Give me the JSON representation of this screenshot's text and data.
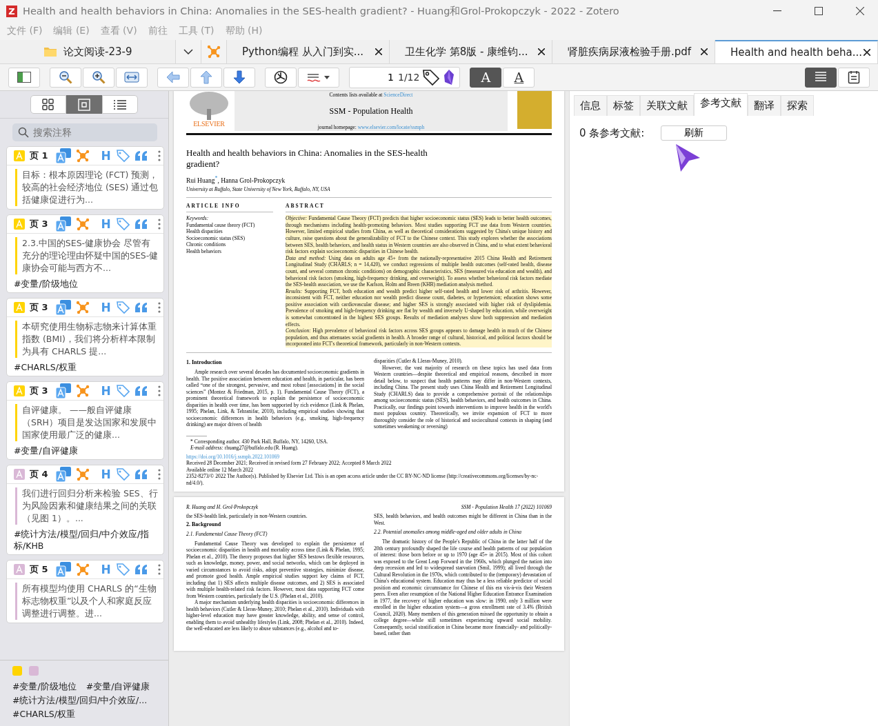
{
  "window": {
    "logo": "Z",
    "title": "Health and health behaviors in China: Anomalies in the SES-health gradient? - Huang和Grol-Prokopczyk - 2022 - Zotero"
  },
  "menu": [
    "文件 (F)",
    "编辑 (E)",
    "查看 (V)",
    "前往",
    "工具 (T)",
    "帮助 (H)"
  ],
  "tabs": [
    {
      "kind": "library",
      "label": "论文阅读-23-9",
      "selected": false
    },
    {
      "kind": "document",
      "label": "Python编程 从入门到实...",
      "selected": false
    },
    {
      "kind": "document",
      "label": "卫生化学 第8版 - 康维钧...",
      "selected": false
    },
    {
      "kind": "document",
      "label": "肾脏疾病尿液检验手册.pdf",
      "selected": false
    },
    {
      "kind": "document",
      "label": "Health and health beha...",
      "selected": true
    }
  ],
  "toolbar": {
    "page_input": "1",
    "page_count": "1/12",
    "font_buttons": [
      {
        "glyph": "A",
        "selected": true
      },
      {
        "glyph": "A",
        "selected": false
      }
    ],
    "views": [
      {
        "selected": true
      },
      {
        "selected": false
      }
    ]
  },
  "annotation_views": [
    {
      "selected": false
    },
    {
      "selected": true
    },
    {
      "selected": false
    }
  ],
  "annotation_search": {
    "placeholder": "搜索注释"
  },
  "annotations": [
    {
      "color": "#ffd400",
      "page": "页 1",
      "heading_glyph": "H",
      "text": "目标：根本原因理论 (FCT) 预测，较高的社会经济地位 (SES) 通过包括健康促进行为..."
    },
    {
      "color": "#ffd400",
      "page": "页 3",
      "heading_glyph": "H",
      "text": "2.3.中国的SES-健康协会 尽管有充分的理论理由怀疑中国的SES-健康协会可能与西方不...",
      "tag": "#变量/阶级地位"
    },
    {
      "color": "#ffd400",
      "page": "页 3",
      "heading_glyph": "H",
      "text": "本研究使用生物标志物来计算体重指数 (BMI)，我们将分析样本限制为具有 CHARLS 提...",
      "tag": "#CHARLS/权重"
    },
    {
      "color": "#ffd400",
      "page": "页 3",
      "heading_glyph": "H",
      "text": "自评健康。 ——般自评健康（SRH）项目是发达国家和发展中国家使用最广泛的健康...",
      "tag": "#变量/自评健康"
    },
    {
      "color": "#d9b8d6",
      "page": "页 4",
      "heading_glyph": "H",
      "text": "我们进行回归分析来检验 SES、行为风险因素和健康结果之间的关联（见图 1）。...",
      "tag": "#统计方法/模型/回归/中介效应/指标/KHB"
    },
    {
      "color": "#d9b8d6",
      "page": "页 5",
      "heading_glyph": "H",
      "text": "所有模型均使用 CHARLS 的“生物标志物权重”以及个人和家庭反应调整进行调整。进..."
    }
  ],
  "annotation_filters": {
    "colors": [
      {
        "color": "#ffd400"
      },
      {
        "color": "#d9b8d6"
      }
    ],
    "tags": [
      "#变量/阶级地位",
      "#变量/自评健康",
      "#统计方法/模型/回归/中介效应/...",
      "#CHARLS/权重"
    ]
  },
  "page_1": {
    "contents_line": "Contents lists available at **ScienceDirect**",
    "journal": "SSM - Population Health",
    "homepage": "journal homepage: **www.elsevier.com/locate/ssmph**",
    "publisher": "ELSEVIER",
    "title": "Health and health behaviors in China: Anomalies in the SES-health gradient?",
    "authors": "Rui Huang$^{*}$, Hanna Grol-Prokopczyk",
    "affiliation": "University at Buffalo, State University of New York, Buffalo, NY, USA",
    "article_info_heading": "ARTICLE INFO",
    "keywords_label": "Keywords:",
    "keywords": [
      "Fundamental cause theory (FCT)",
      "Health disparities",
      "Socioeconomic status (SES)",
      "Chronic conditions",
      "Health behaviors"
    ],
    "abstract_heading": "ABSTRACT",
    "abstract_highlighted": true,
    "abstract": [
      "*Objective:* Fundamental Cause Theory (FCT) predicts that higher socioeconomic status (SES) leads to better health outcomes, through mechanisms including health-promoting behaviors. Most studies supporting FCT use data from Western countries. However, limited empirical studies from China, as well as theoretical considerations suggested by China's unique history and culture, raise questions about the generalizability of FCT to the Chinese context. This study explores whether the associations between SES, health behaviors, and health status in Western countries are also observed in China, and to what extent behavioral risk factors explain socioeconomic disparities in Chinese health.",
      "*Data and method:* Using data on adults age 45+ from the nationally-representative 2015 China Health and Retirement Longitudinal Study (CHARLS; n = 14,420), we conduct regressions of multiple health outcomes (self-rated health, disease count, and several common chronic conditions) on demographic characteristics, SES (measured via education and wealth), and behavioral risk factors (smoking, high-frequency drinking, and overweight). To assess whether behavioral risk factors mediate the SES-health association, we use the Karlson, Holm and Breen (KHB) mediation analysis method.",
      "*Results:* Supporting FCT, both education and wealth predict higher self-rated health and lower risk of arthritis. However, inconsistent with FCT, neither education nor wealth predict disease count, diabetes, or hypertension; education shows some positive association with cardiovascular disease; and higher SES is strongly associated with higher risk of dyslipidemia. Prevalence of smoking and high-frequency drinking are flat by wealth and inversely U-shaped by education, while overweight is somewhat concentrated in the highest SES groups. Results of mediation analyses show both suppression and mediation effects.",
      "*Conclusion:* High prevalence of behavioral risk factors across SES groups appears to damage health in much of the Chinese population, and thus attenuates social gradients in health. A broader range of cultural, historical, and political factors should be incorporated into FCT's theoretical framework, particularly in non-Western contexts."
    ],
    "intro_heading": "1.  Introduction",
    "intro_left": [
      "Ample research over several decades has documented socioeconomic gradients in health. The positive association between education and health, in particular, has been called “one of the strongest, pervasive, and most robust [associations] in the social sciences” (Montez & Friedman, 2015, p. 1). Fundamental Cause Theory (FCT), a prominent theoretical framework to explain the persistence of socioeconomic disparities in health over time, has been supported by rich evidence (Link & Phelan, 1995; Phelan, Link, & Tehranifar, 2010), including empirical studies showing that socioeconomic differences in health behaviors (e.g., smoking, high-frequency drinking) are major drivers of health"
    ],
    "intro_right": [
      "disparities (Cutler & Lleras-Muney, 2010).",
      "However, the vast majority of research on these topics has used data from Western countries—despite theoretical and empirical reasons, described in more detail below, to suspect that health patterns may differ in non-Western contexts, including China. The present study uses China Health and Retirement Longitudinal Study (CHARLS) data to provide a comprehensive portrait of the relationships among socioeconomic status (SES), health behaviors, and health outcomes in China. Practically, our findings point towards interventions to improve health in the world's most populous country. Theoretically, we invite expansion of FCT to more thoroughly consider the role of historical and sociocultural contexts in shaping (and sometimes weakening or reversing)"
    ],
    "footnotes": [
      "* Corresponding author. 430 Park Hall, Buffalo, NY, 14260, USA.",
      "*E-mail address:* rhuang27@buffalo.edu (R. Huang)."
    ],
    "doi": "https://doi.org/10.1016/j.ssmph.2022.101069",
    "dates": [
      "Received 28 December 2021; Received in revised form 27 February 2022; Accepted 8 March 2022",
      "Available online 12 March 2022",
      "2352-8273/© 2022 The Author(s). Published by Elsevier Ltd. This is an open access article under the CC BY-NC-ND license (http://creativecommons.org/licenses/by-nc-nd/4.0/)."
    ]
  },
  "page_2": {
    "running_left": "R. Huang and H. Grol-Prokopczyk",
    "running_right": "SSM - Population Health 17 (2022) 101069",
    "left": [
      {
        "kind": "text",
        "text": "the SES-health link, particularly in non-Western countries."
      },
      {
        "kind": "heading",
        "text": "2.  Background"
      },
      {
        "kind": "subheading",
        "text": "2.1.  Fundamental Cause Theory (FCT)"
      },
      {
        "kind": "paragraph",
        "text": "Fundamental Cause Theory was developed to explain the persistence of socioeconomic disparities in health and mortality across time (Link & Phelan, 1995; Phelan et al., 2010). The theory proposes that higher SES bestows flexible resources, such as knowledge, money, power, and social networks, which can be deployed in varied circumstances to avoid risks, adopt preventive strategies, minimize disease, and promote good health. Ample empirical studies support key claims of FCT, including that 1) SES affects multiple disease outcomes, and 2) SES is associated with multiple health-related risk factors. However, most data supporting FCT come from Western countries, particularly the U.S. (Phelan et al., 2010)."
      },
      {
        "kind": "paragraph",
        "text": "A major mechanism underlying health disparities is socioeconomic differences in health behaviors (Cutler & Lleras-Muney, 2010; Phelan et al., 2010). Individuals with higher-level education may have greater knowledge, ability, and sense of control, enabling them to avoid unhealthy lifestyles (Link, 2008; Phelan et al., 2010). Indeed, the well-educated are less likely to abuse substances (e.g., alcohol and to-"
      }
    ],
    "right": [
      {
        "kind": "text",
        "text": "SES, health behaviors, and health outcomes might be different in China than in the West."
      },
      {
        "kind": "subheading",
        "text": "2.2.  Potential anomalies among middle-aged and older adults in China"
      },
      {
        "kind": "paragraph",
        "text": "The dramatic history of the People's Republic of China in the latter half of the 20th century profoundly shaped the life course and health patterns of our population of interest: those born before or up to 1970 (age 45+ in 2015). Most of this cohort was exposed to the Great Leap Forward in the 1960s, which plunged the nation into deep recession and led to widespread starvation (Smil, 1999); all lived through the Cultural Revolution in the 1970s, which contributed to the (temporary) devastation of China's educational system. Education may thus be a less reliable predictor of social position and economic circumstance for Chinese of this era vis-à-vis their Western peers. Even after resumption of the National Higher Education Entrance Examination in 1977, the recovery of higher education was slow: in 1990, only 3 million were enrolled in the higher education system—a gross enrollment rate of 3.4% (British Council, 2020). Many members of this generation missed the opportunity to obtain a college degree—while still sometimes experiencing upward social mobility. Consequently, social stratification in China became more financially- and politically-based, rather than"
      }
    ]
  },
  "item_pane": {
    "tabs": [
      {
        "label": "信息",
        "selected": false
      },
      {
        "label": "标签",
        "selected": false
      },
      {
        "label": "关联文献",
        "selected": false
      },
      {
        "label": "参考文献",
        "selected": true
      },
      {
        "label": "翻译",
        "selected": false
      },
      {
        "label": "探索",
        "selected": false
      }
    ],
    "references_count": "0 条参考文献:",
    "refresh_button": "刷新"
  }
}
